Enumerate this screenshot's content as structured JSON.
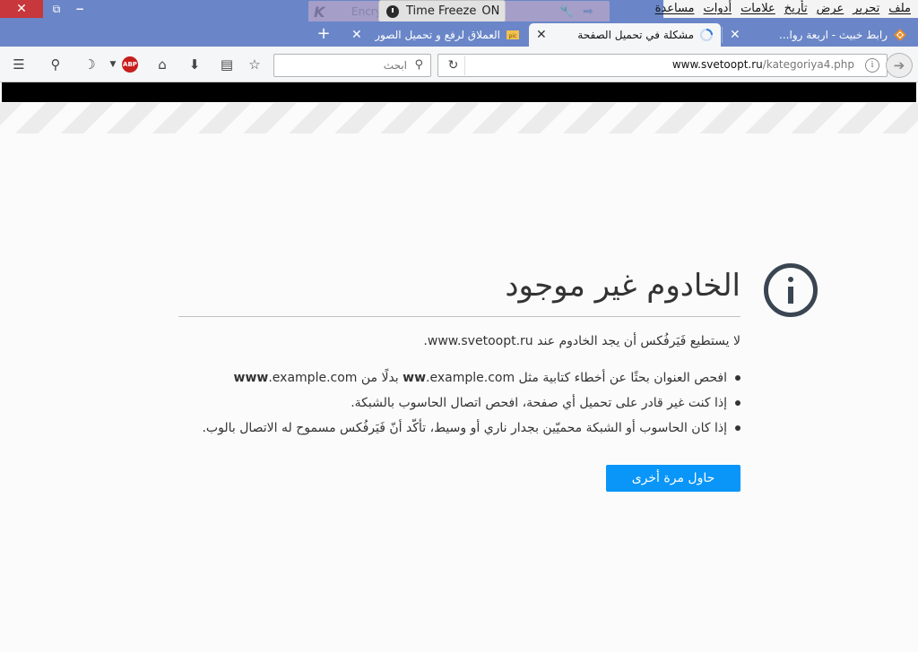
{
  "menubar": {
    "items": [
      "ملف",
      "تحرير",
      "عرض",
      "تأريخ",
      "علامات",
      "أدوات",
      "مساعدة"
    ]
  },
  "window_controls": {
    "close": "✕",
    "restore": "⧉",
    "minimize": "−"
  },
  "addon_overlay": {
    "text": "Encryption Time 00:00"
  },
  "time_freeze": {
    "label": "Time Freeze",
    "state": "ON"
  },
  "tabs": [
    {
      "title": "رابط خبيث - اربعة روا...",
      "selected": false
    },
    {
      "title": "مشكلة في تحميل الصفحة",
      "selected": true
    },
    {
      "title": "العملاق لرفع و تحميل الصور",
      "selected": false
    }
  ],
  "new_tab_label": "+",
  "navbar": {
    "search_placeholder": "ابحث",
    "url_host": "www.svetoopt.ru",
    "url_path": "/kategoriya4.php",
    "abp_label": "ABP"
  },
  "error_page": {
    "title": "الخادوم غير موجود",
    "subtitle": "لا يستطيع فَيَرفُكس أن يجد الخادوم عند www.svetoopt.ru.",
    "bullet1_pre": "افحص العنوان بحثًا عن أخطاء كتابية مثل ",
    "bullet1_b1": "ww",
    "bullet1_mid1": ".example.com بدلًا من ",
    "bullet1_b2": "www",
    "bullet1_post": ".example.com",
    "bullet2": "إذا كنت غير قادر على تحميل أي صفحة، افحص اتصال الحاسوب بالشبكة.",
    "bullet3": "إذا كان الحاسوب أو الشبكة محميّين بجدار ناري أو وسيط، تأكّد أنّ فَيَرفُكس مسموح له الاتصال بالوب.",
    "retry_label": "حاول مرة أخرى"
  }
}
